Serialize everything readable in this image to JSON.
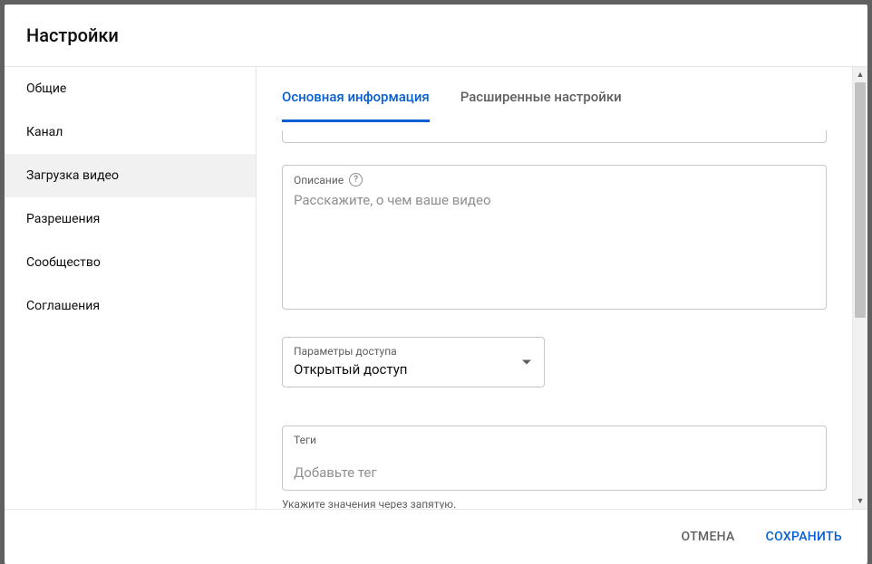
{
  "header": {
    "title": "Настройки"
  },
  "sidebar": {
    "items": [
      {
        "label": "Общие"
      },
      {
        "label": "Канал"
      },
      {
        "label": "Загрузка видео"
      },
      {
        "label": "Разрешения"
      },
      {
        "label": "Сообщество"
      },
      {
        "label": "Соглашения"
      }
    ]
  },
  "tabs": {
    "basic": "Основная информация",
    "advanced": "Расширенные настройки"
  },
  "description": {
    "label": "Описание",
    "placeholder": "Расскажите, о чем ваше видео",
    "value": ""
  },
  "visibility": {
    "label": "Параметры доступа",
    "value": "Открытый доступ"
  },
  "tags": {
    "label": "Теги",
    "placeholder": "Добавьте тег",
    "value": "",
    "hint": "Укажите значения через запятую."
  },
  "footer": {
    "cancel": "ОТМЕНА",
    "save": "СОХРАНИТЬ"
  },
  "icons": {
    "help": "?"
  }
}
